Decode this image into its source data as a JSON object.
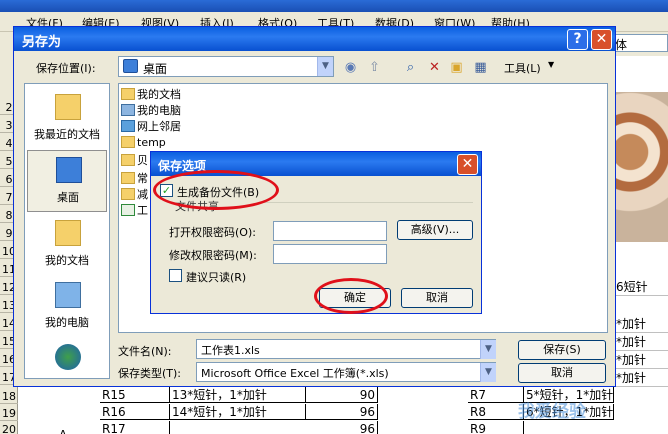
{
  "excel": {
    "menu": [
      "文件(F)",
      "编辑(E)",
      "视图(V)",
      "插入(I)",
      "格式(O)",
      "工具(T)",
      "数据(D)",
      "窗口(W)",
      "帮助(H)"
    ],
    "font_box": "体",
    "row_numbers": [
      "2",
      "3",
      "4",
      "5",
      "6",
      "7",
      "8",
      "9",
      "10",
      "11",
      "12",
      "13",
      "14",
      "15",
      "16",
      "17",
      "18",
      "19",
      "20"
    ],
    "right_cells": [
      "6短针",
      "*加针",
      "*加针",
      "*加针",
      "*加针",
      "*加针"
    ],
    "bottom_rows": [
      {
        "a": "R15",
        "b": "13*短针，1*加针",
        "c": "90",
        "d": "R7",
        "e": "5*短针，1*加针"
      },
      {
        "a": "R16",
        "b": "14*短针，1*加针",
        "c": "96",
        "d": "R8",
        "e": "6*短针，1*加针"
      },
      {
        "a": "R17",
        "b": "",
        "c": "96",
        "d": "R9",
        "e": ""
      }
    ],
    "merged_cell": "A",
    "watermark": "我爱经验"
  },
  "saveas": {
    "title": "另存为",
    "help_label": "?",
    "close_label": "✕",
    "location_label": "保存位置(I):",
    "location_value": "桌面",
    "tools_label": "工具(L)",
    "places": [
      {
        "label": "我最近的文档",
        "icon": "recent-docs-icon"
      },
      {
        "label": "桌面",
        "icon": "desktop-icon"
      },
      {
        "label": "我的文档",
        "icon": "my-documents-icon"
      },
      {
        "label": "我的电脑",
        "icon": "my-computer-icon"
      }
    ],
    "files": [
      "我的文档",
      "我的电脑",
      "网上邻居",
      "temp",
      "贝",
      "常",
      "减",
      "工"
    ],
    "filename_label": "文件名(N):",
    "filename_value": "工作表1.xls",
    "filetype_label": "保存类型(T):",
    "filetype_value": "Microsoft Office Excel 工作簿(*.xls)",
    "save_label": "保存(S)",
    "cancel_label": "取消"
  },
  "options": {
    "title": "保存选项",
    "backup_label": "生成备份文件(B)",
    "backup_checked": "✓",
    "file_sharing_label": "文件共享",
    "open_pwd_label": "打开权限密码(O):",
    "modify_pwd_label": "修改权限密码(M):",
    "advanced_label": "高级(V)...",
    "readonly_label": "建议只读(R)",
    "ok_label": "确定",
    "cancel_label": "取消"
  }
}
